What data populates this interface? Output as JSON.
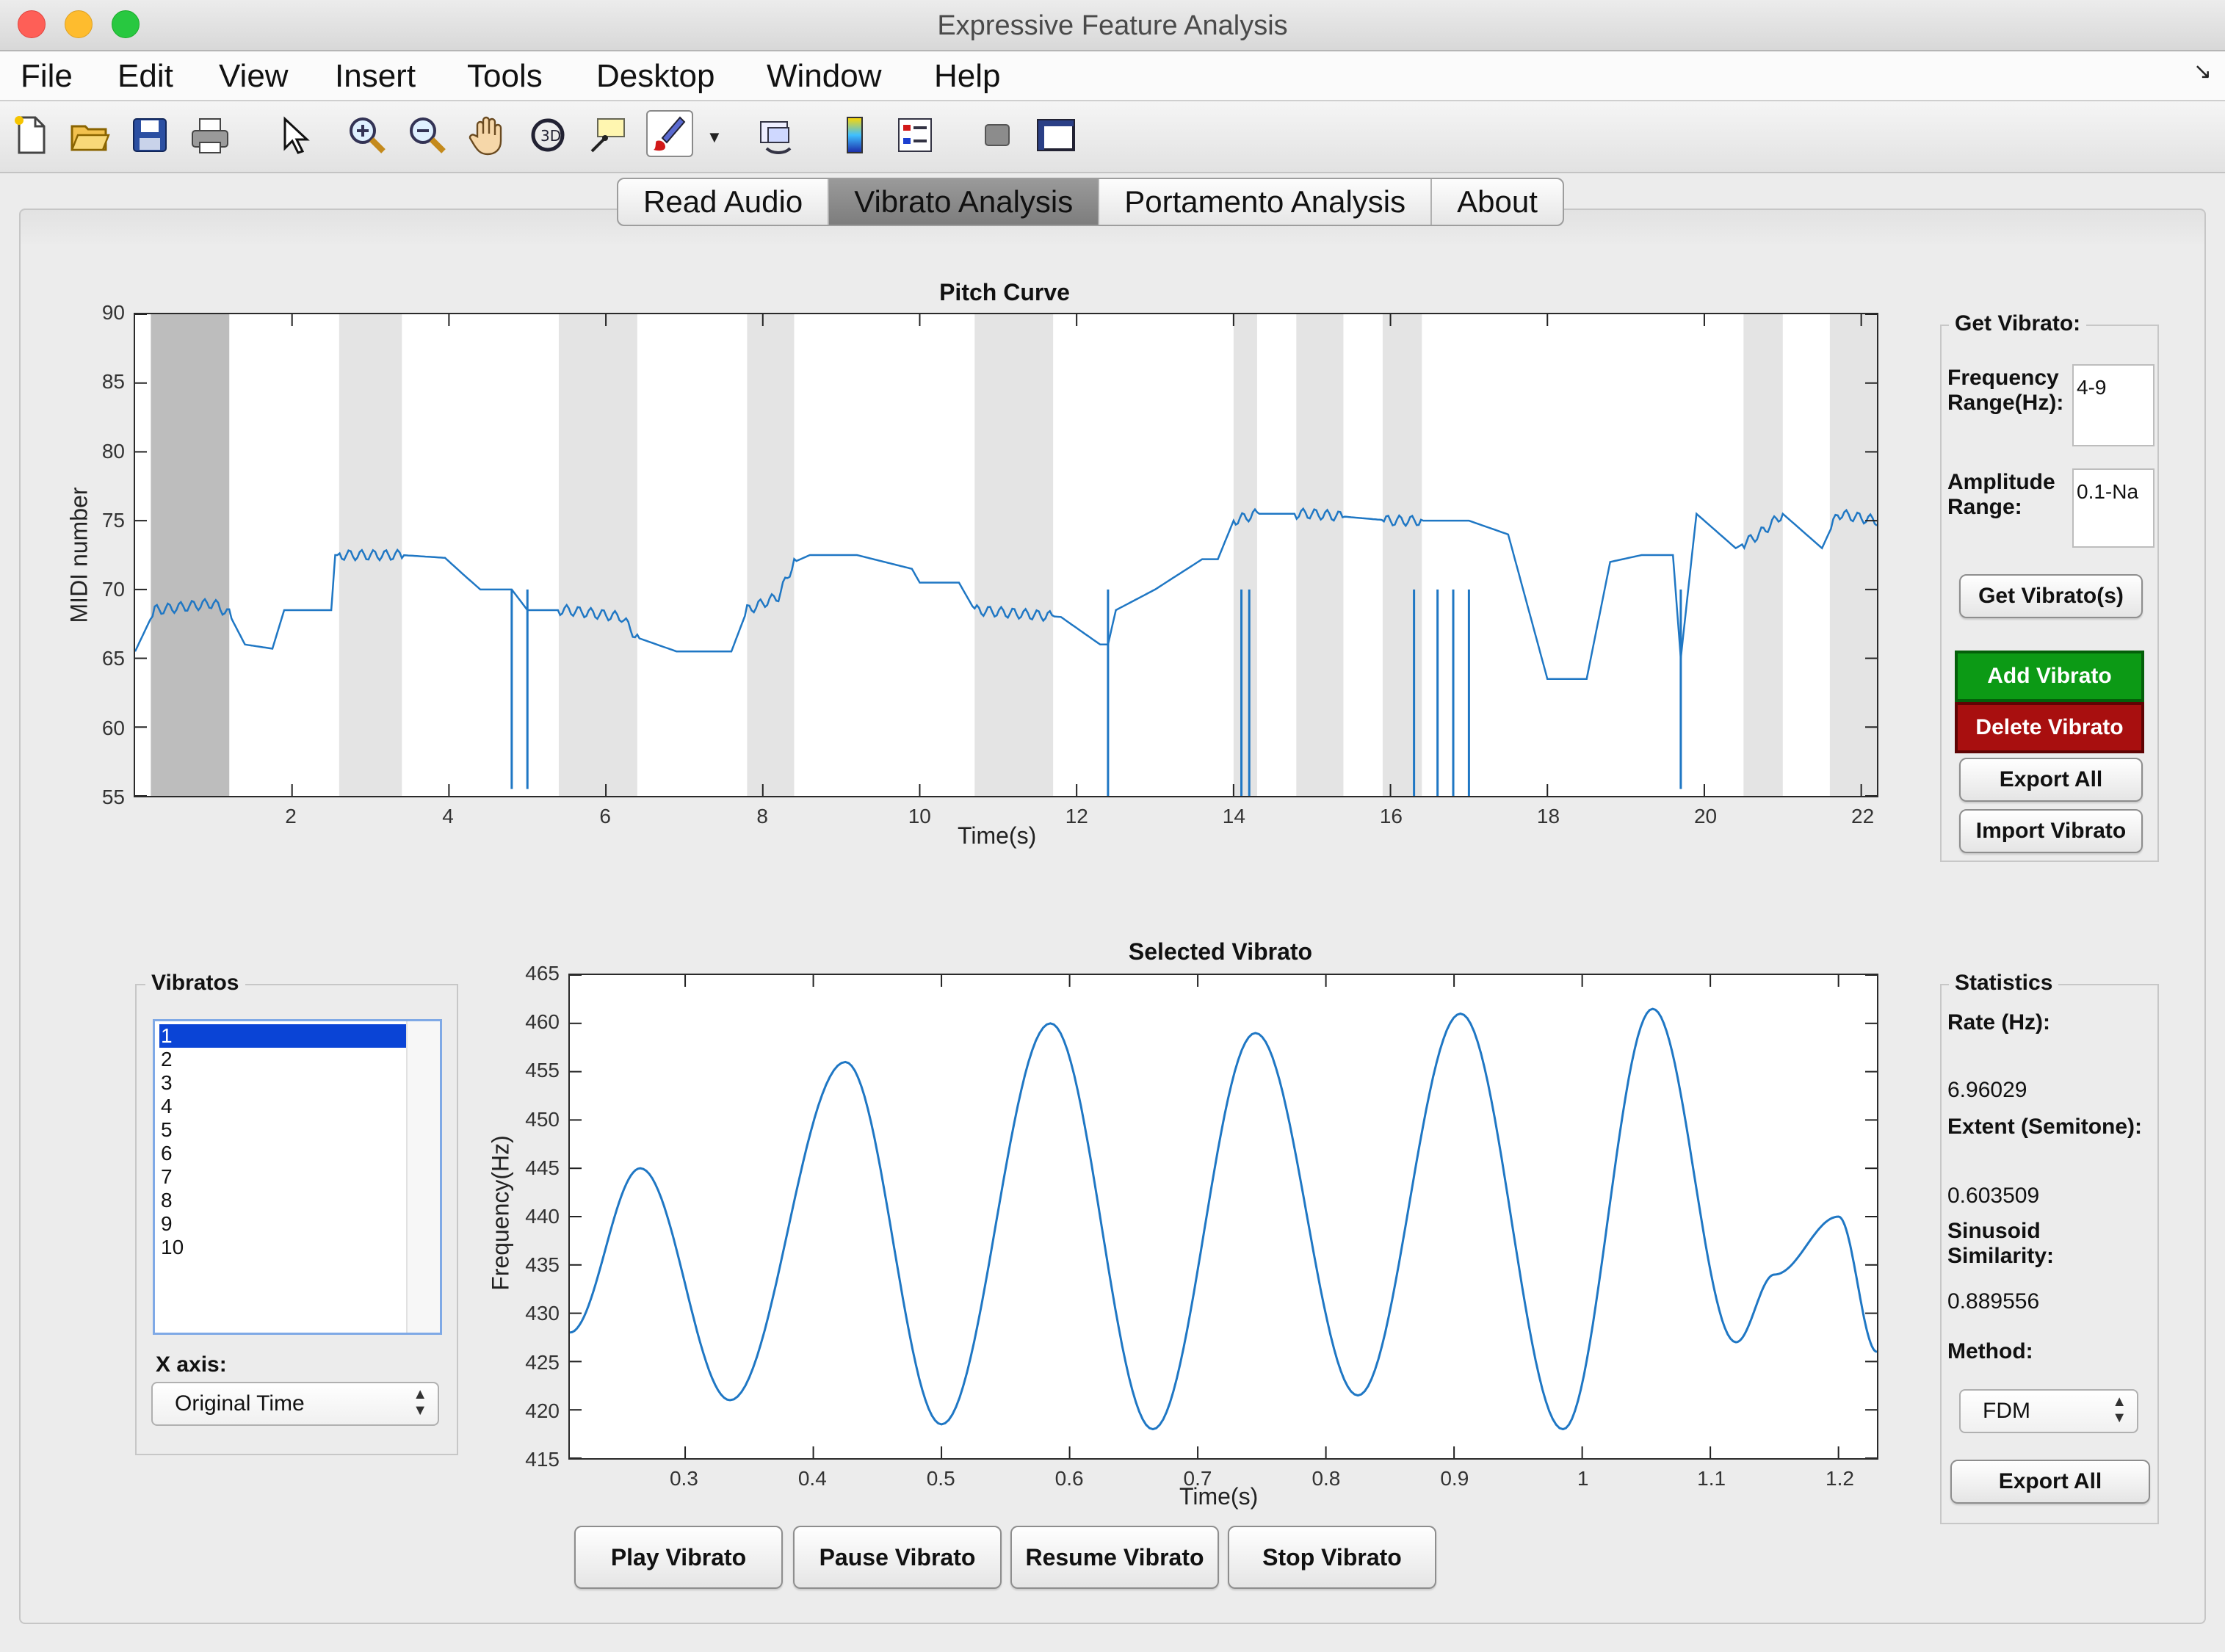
{
  "window": {
    "title": "Expressive Feature Analysis"
  },
  "menu": [
    "File",
    "Edit",
    "View",
    "Insert",
    "Tools",
    "Desktop",
    "Window",
    "Help"
  ],
  "tabs": [
    {
      "label": "Read Audio",
      "active": false
    },
    {
      "label": "Vibrato Analysis",
      "active": true
    },
    {
      "label": "Portamento Analysis",
      "active": false
    },
    {
      "label": "About",
      "active": false
    }
  ],
  "pitch_panel": {
    "title": "Pitch Curve",
    "xlabel": "Time(s)",
    "ylabel": "MIDI number",
    "xticks": [
      "2",
      "4",
      "6",
      "8",
      "10",
      "12",
      "14",
      "16",
      "18",
      "20",
      "22"
    ],
    "yticks": [
      "55",
      "60",
      "65",
      "70",
      "75",
      "80",
      "85",
      "90"
    ]
  },
  "vibrato_panel": {
    "title": "Selected Vibrato",
    "xlabel": "Time(s)",
    "ylabel": "Frequency(Hz)",
    "xticks": [
      "0.3",
      "0.4",
      "0.5",
      "0.6",
      "0.7",
      "0.8",
      "0.9",
      "1",
      "1.1",
      "1.2"
    ],
    "yticks": [
      "415",
      "420",
      "425",
      "430",
      "435",
      "440",
      "445",
      "450",
      "455",
      "460",
      "465"
    ]
  },
  "get_vibrato": {
    "title": "Get Vibrato:",
    "freq_label_1": "Frequency",
    "freq_label_2": "Range(Hz):",
    "freq_value": "4-9",
    "amp_label_1": "Amplitude",
    "amp_label_2": "Range:",
    "amp_value": "0.1-Na",
    "get_button": "Get Vibrato(s)",
    "add_button": "Add Vibrato",
    "delete_button": "Delete Vibrato",
    "export_button": "Export All",
    "import_button": "Import Vibrato",
    "add_color": "#0c9a15",
    "delete_color": "#a80f0f"
  },
  "vibratos": {
    "title": "Vibratos",
    "items": [
      "1",
      "2",
      "3",
      "4",
      "5",
      "6",
      "7",
      "8",
      "9",
      "10"
    ],
    "selected_index": 0,
    "xaxis_label": "X axis:",
    "xaxis_value": "Original Time"
  },
  "statistics": {
    "title": "Statistics",
    "rate_label": "Rate (Hz):",
    "rate_value": "6.96029",
    "extent_label": "Extent (Semitone):",
    "extent_value": "0.603509",
    "sinusoid_label_1": "Sinusoid",
    "sinusoid_label_2": "Similarity:",
    "sinusoid_value": "0.889556",
    "method_label": "Method:",
    "method_value": "FDM",
    "export_button": "Export All"
  },
  "playback": {
    "play": "Play Vibrato",
    "pause": "Pause Vibrato",
    "resume": "Resume Vibrato",
    "stop": "Stop Vibrato"
  },
  "chart_data": [
    {
      "type": "line",
      "title": "Pitch Curve",
      "xlabel": "Time(s)",
      "ylabel": "MIDI number",
      "xlim": [
        0,
        22.2
      ],
      "ylim": [
        55,
        90
      ],
      "line_color": "#1f77c4",
      "vibrato_regions": [
        [
          0.2,
          1.2
        ],
        [
          2.6,
          3.4
        ],
        [
          5.4,
          6.4
        ],
        [
          7.8,
          8.4
        ],
        [
          10.7,
          11.7
        ],
        [
          14.0,
          14.3
        ],
        [
          14.8,
          15.4
        ],
        [
          15.9,
          16.4
        ],
        [
          20.5,
          21.0
        ],
        [
          21.6,
          22.2
        ]
      ],
      "selected_region": [
        0.2,
        1.2
      ],
      "series": [
        {
          "x": [
            0.0,
            0.25,
            1.0,
            1.2,
            1.4,
            1.75,
            1.9,
            2.5,
            2.55,
            3.4,
            3.95,
            4.2,
            4.4,
            4.8,
            5.0,
            5.5,
            6.2,
            6.4,
            6.9,
            7.6,
            7.8,
            8.2,
            8.4,
            8.6,
            9.2,
            9.9,
            10.0,
            10.5,
            10.7,
            11.8,
            12.3,
            12.4,
            12.5,
            13.0,
            13.6,
            13.8,
            14.0,
            14.3,
            15.0,
            16.0,
            17.0,
            17.5,
            18.0,
            18.5,
            18.8,
            19.2,
            19.6,
            19.7,
            19.9,
            20.4,
            20.7,
            21.0,
            21.3,
            21.5,
            21.7,
            22.2
          ],
          "y": [
            65.5,
            68.5,
            69.0,
            68.2,
            66.0,
            65.7,
            68.5,
            68.5,
            72.5,
            72.5,
            72.3,
            71.0,
            70.0,
            70.0,
            68.5,
            68.5,
            68.0,
            66.5,
            65.5,
            65.5,
            68.5,
            69.5,
            72.0,
            72.5,
            72.5,
            71.5,
            70.5,
            70.5,
            68.5,
            68.0,
            66.0,
            66.0,
            68.5,
            70.0,
            72.2,
            72.2,
            75.0,
            75.5,
            75.5,
            75.0,
            75.0,
            74.0,
            63.5,
            63.5,
            72.0,
            72.5,
            72.5,
            65.0,
            75.5,
            73.0,
            74.0,
            75.5,
            74.0,
            73.0,
            75.5,
            75.0
          ]
        }
      ]
    },
    {
      "type": "line",
      "title": "Selected Vibrato",
      "xlabel": "Time(s)",
      "ylabel": "Frequency(Hz)",
      "xlim": [
        0.21,
        1.23
      ],
      "ylim": [
        415,
        465
      ],
      "line_color": "#1f77c4",
      "series": [
        {
          "x": [
            0.21,
            0.265,
            0.335,
            0.425,
            0.5,
            0.585,
            0.665,
            0.745,
            0.825,
            0.905,
            0.985,
            1.055,
            1.12,
            1.15,
            1.2,
            1.23
          ],
          "y": [
            428.0,
            445.0,
            421.0,
            456.0,
            418.5,
            460.0,
            418.0,
            459.0,
            421.5,
            461.0,
            418.0,
            461.5,
            427.0,
            434.0,
            440.0,
            426.0
          ]
        }
      ]
    }
  ]
}
